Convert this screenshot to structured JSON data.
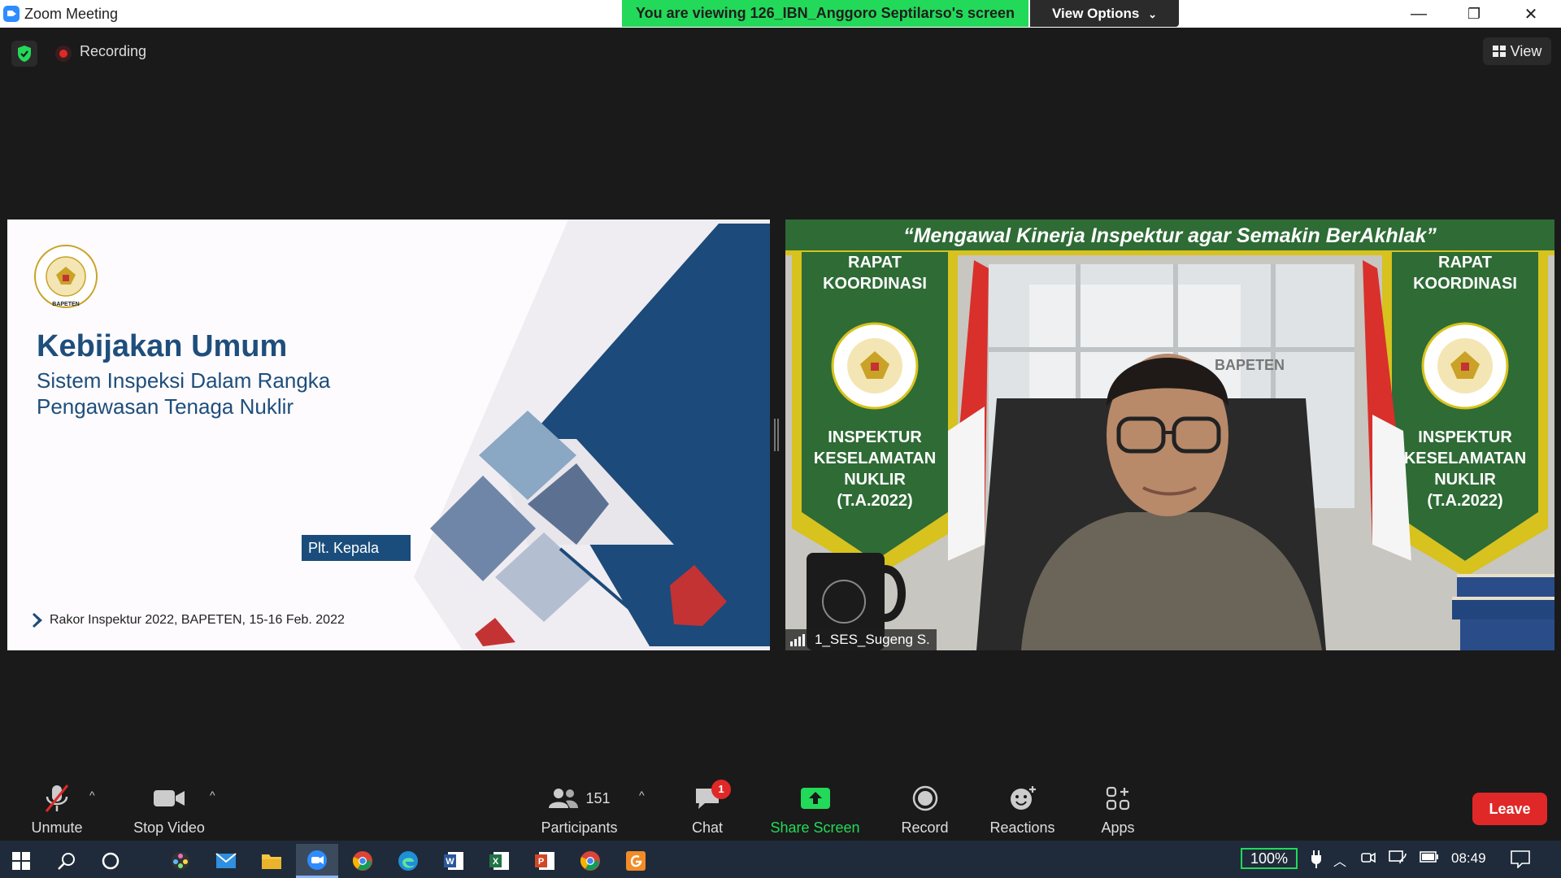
{
  "window": {
    "title": "Zoom Meeting",
    "viewing_banner": "You are viewing 126_IBN_Anggoro Septilarso's screen",
    "view_options": "View Options",
    "minimize": "—",
    "restore": "❐",
    "close": "✕"
  },
  "top": {
    "recording": "Recording",
    "view": "View"
  },
  "slide": {
    "title": "Kebijakan Umum",
    "subtitle_line1": "Sistem Inspeksi Dalam Rangka",
    "subtitle_line2": "Pengawasan Tenaga Nuklir",
    "plt": "Plt. Kepala",
    "footer": "Rakor Inspektur 2022, BAPETEN, 15-16 Feb. 2022",
    "logo_text": "BAPETEN"
  },
  "video": {
    "quote": "“Mengawal Kinerja Inspektur agar Semakin BerAkhlak”",
    "banner_top_1": "RAPAT",
    "banner_top_2": "KOORDINASI",
    "banner_bottom_1": "INSPEKTUR",
    "banner_bottom_2": "KESELAMATAN",
    "banner_bottom_3": "NUKLIR",
    "banner_bottom_4": "(T.A.2022)",
    "building_sign": "BAPETEN",
    "participant_name": "1_SES_Sugeng S."
  },
  "toolbar": {
    "unmute": "Unmute",
    "stop_video": "Stop Video",
    "participants": "Participants",
    "participants_count": "151",
    "chat": "Chat",
    "chat_badge": "1",
    "share_screen": "Share Screen",
    "record": "Record",
    "reactions": "Reactions",
    "apps": "Apps",
    "leave": "Leave",
    "caret": "^"
  },
  "taskbar": {
    "battery": "100%",
    "time": "08:49"
  },
  "colors": {
    "zoom_blue": "#2D8CFF",
    "banner_green": "#23D959",
    "leave_red": "#E02828",
    "slide_navy": "#1a4d7c"
  }
}
